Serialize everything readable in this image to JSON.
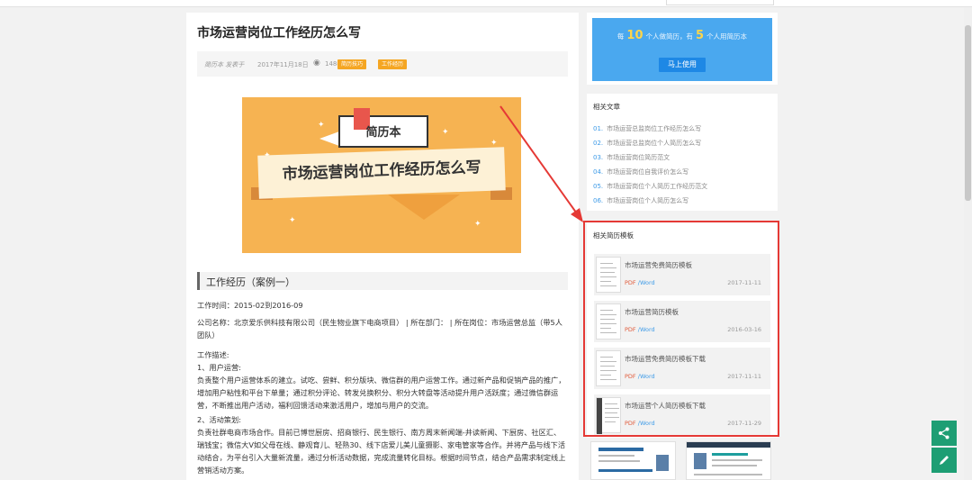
{
  "article": {
    "title": "市场运营岗位工作经历怎么写",
    "meta": {
      "source": "简历本 发表于",
      "date": "2017年11月18日",
      "views": "1484",
      "tags": [
        "简历技巧",
        "工作经历"
      ]
    },
    "banner": {
      "brand": "简历本",
      "headline": "市场运营岗位工作经历怎么写"
    },
    "section_title": "工作经历（案例一）",
    "paragraphs": [
      "工作时间：2015-02到2016-09",
      "公司名称：北京爱乐供科技有限公司（民生物业旗下电商项目） | 所在部门： | 所在岗位：市场运营总监（带5人团队）",
      "工作描述:",
      "1、用户运营:",
      "负责整个用户运营体系的建立。试吃、尝鲜、积分版块、微信群的用户运营工作。通过新产品和促销产品的推广，增加用户粘性和平台下单量；通过积分评论、转发兑换积分、积分大转盘等活动提升用户活跃度；通过微信群运营，不断推出用户活动，福利回馈活动来激活用户，增加与用户的交流。",
      "2、活动策划:",
      "负责社群电商市场合作。目前已博世厨房、招商银行、民生银行、南方周末新闻端-井读新闻、下厨房、社区汇、瑞钱宝；微信大V如父母在线、静观育儿、轻熟30、线下店爱儿美儿童摄影、家电管家等合作。并将产品与线下活动结合，为平台引入大量新流量，通过分析活动数据，完成流量转化目标。根据时间节点，结合产品需求制定线上营销活动方案。"
    ]
  },
  "promo": {
    "prefix": "每",
    "count1": "10",
    "mid": "个人做简历，有",
    "count2": "5",
    "suffix": "个人用简历本",
    "button": "马上使用"
  },
  "related_articles": {
    "title": "相关文章",
    "items": [
      {
        "idx": "01.",
        "label": "市场运营总监岗位工作经历怎么写"
      },
      {
        "idx": "02.",
        "label": "市场运营总监岗位个人简历怎么写"
      },
      {
        "idx": "03.",
        "label": "市场运营岗位简历范文"
      },
      {
        "idx": "04.",
        "label": "市场运营岗位自我评价怎么写"
      },
      {
        "idx": "05.",
        "label": "市场运营岗位个人简历工作经历范文"
      },
      {
        "idx": "06.",
        "label": "市场运营岗位个人简历怎么写"
      }
    ]
  },
  "related_templates": {
    "title": "相关简历模板",
    "items": [
      {
        "name": "市场运营免费简历模板",
        "pdf": "PDF",
        "word": "/Word",
        "date": "2017-11-11"
      },
      {
        "name": "市场运营简历模板",
        "pdf": "PDF",
        "word": "/Word",
        "date": "2016-03-16"
      },
      {
        "name": "市场运营免费简历模板下载",
        "pdf": "PDF",
        "word": "/Word",
        "date": "2017-11-11"
      },
      {
        "name": "市场运营个人简历模板下载",
        "pdf": "PDF",
        "word": "/Word",
        "date": "2017-11-29"
      }
    ]
  },
  "icons": {
    "share": "share-icon",
    "edit": "pencil-icon",
    "views": "eye-icon"
  },
  "colors": {
    "accent": "#4aa8ef",
    "tag": "#f5a623",
    "highlight": "#e53935",
    "fab": "#1e9e74"
  }
}
